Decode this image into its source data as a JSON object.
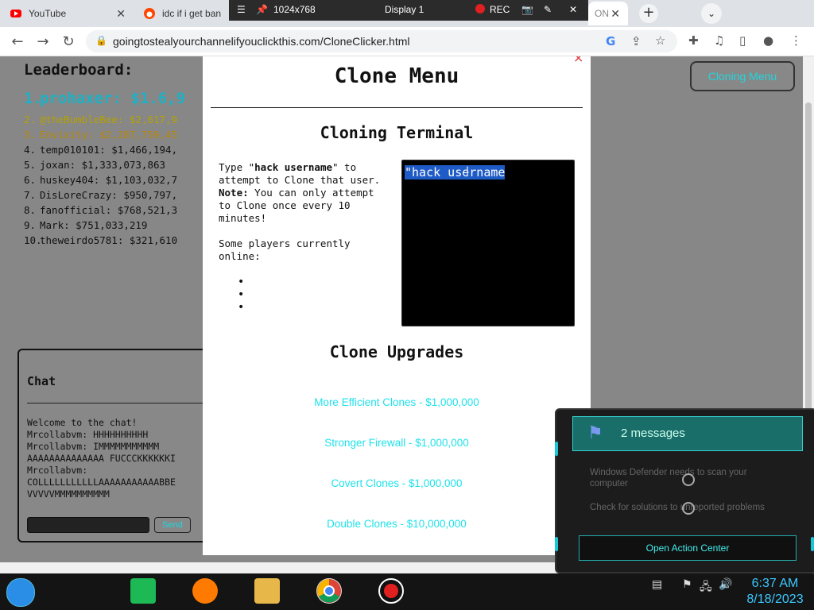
{
  "tabs": [
    {
      "label": "YouTube",
      "icon": "youtube-icon"
    },
    {
      "label": "idc if i get ban",
      "icon": "reddit-icon"
    },
    {
      "label": "ON",
      "icon": "page-icon"
    }
  ],
  "recorder": {
    "resolution": "1024x768",
    "display": "Display 1",
    "rec_label": "REC"
  },
  "address_bar": {
    "url": "goingtostealyourchannelifyouclickthis.com/CloneClicker.html"
  },
  "leaderboard": {
    "title": "Leaderboard:",
    "rows": [
      {
        "rank": "1.",
        "entry": "prohaxer: $1.6,9"
      },
      {
        "rank": "2.",
        "entry": "@theBumbleBee: $2,617,9"
      },
      {
        "rank": "3.",
        "entry": "Envixity: $2,287,759,45"
      },
      {
        "rank": "4.",
        "entry": "temp010101: $1,466,194,"
      },
      {
        "rank": "5.",
        "entry": "joxan: $1,333,073,863"
      },
      {
        "rank": "6.",
        "entry": "huskey404: $1,103,032,7"
      },
      {
        "rank": "7.",
        "entry": "DisLoreCrazy: $950,797,"
      },
      {
        "rank": "8.",
        "entry": "fanofficial: $768,521,3"
      },
      {
        "rank": "9.",
        "entry": "Mark: $751,033,219"
      },
      {
        "rank": "10.",
        "entry": "theweirdo5781: $321,610"
      }
    ]
  },
  "clone_menu_button": "Cloning Menu",
  "chat": {
    "title": "Chat",
    "messages": "Welcome to the chat!\nMrcollabvm: HHHHHHHHHH\nMrcollabvm: IMMMMMMMMMMM\nAAAAAAAAAAAAAA FUCCCKKKKKKI\nMrcollabvm:\nCOLLLLLLLLLLLAAAAAAAAAAABBE\nVVVVVMMMMMMMMMM",
    "send_label": "Send"
  },
  "modal": {
    "title": "Clone Menu",
    "close": "×",
    "terminal_title": "Cloning Terminal",
    "instructions_html_parts": {
      "type": "Type \"",
      "cmd": "hack username",
      "after": "\" to attempt to Clone that user. ",
      "note_label": "Note:",
      "note": " You can only attempt to Clone once every 10 minutes!",
      "online": "Some players currently online:"
    },
    "terminal_text": "\"hack username",
    "upgrades_title": "Clone Upgrades",
    "upgrades": [
      "More Efficient Clones - $1,000,000",
      "Stronger Firewall - $1,000,000",
      "Covert Clones - $1,000,000",
      "Double Clones - $10,000,000"
    ]
  },
  "notification": {
    "count": "2 messages",
    "items": [
      "Windows Defender needs to scan your computer",
      "Check for solutions to unreported problems"
    ],
    "button": "Open Action Center"
  },
  "clock": {
    "time": "6:37 AM",
    "date": "8/18/2023"
  },
  "colors": {
    "accent_cyan": "#1fe2ea",
    "leader_gold": "#b5a100",
    "leader_first": "#1fb0c4"
  }
}
